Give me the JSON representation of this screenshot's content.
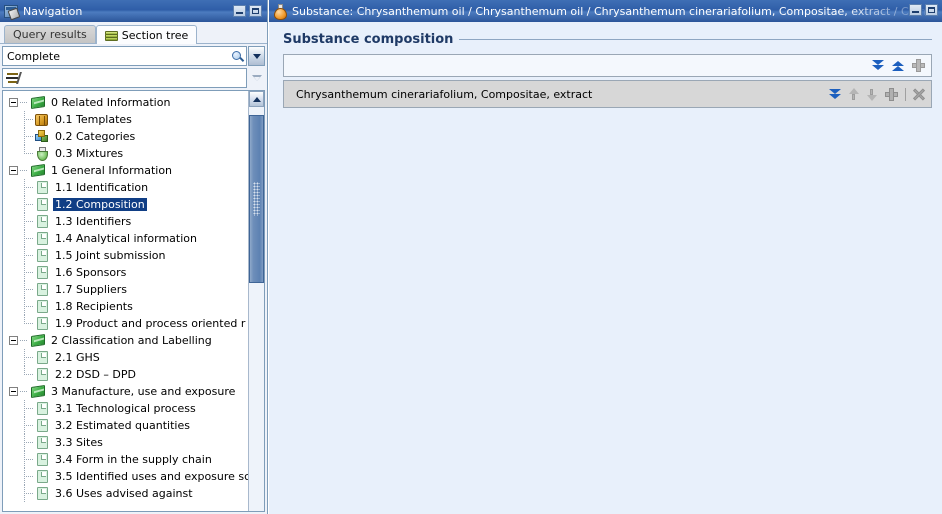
{
  "navigation": {
    "title": "Navigation",
    "icon": "navigation-window-icon",
    "window_buttons": {
      "minimize": "Minimize",
      "maximize": "Maximize"
    },
    "tabs": [
      {
        "label": "Query results",
        "active": false,
        "icon": "none"
      },
      {
        "label": "Section tree",
        "active": true,
        "icon": "stack-icon"
      }
    ],
    "view_combo": {
      "value": "Complete",
      "search_icon": "magnifier-icon",
      "dropdown_icon": "chevron-down-icon"
    },
    "filter": {
      "value": "",
      "placeholder": "",
      "icon": "filter-icon",
      "dropdown_icon": "chevron-down-open-icon"
    },
    "tree": [
      {
        "label": "0 Related Information",
        "level": 0,
        "icon": "book-icon",
        "expander": "minus",
        "selected": false
      },
      {
        "label": "0.1 Templates",
        "level": 1,
        "icon": "template-icon",
        "expander": "none",
        "selected": false
      },
      {
        "label": "0.2 Categories",
        "level": 1,
        "icon": "categories-icon",
        "expander": "none",
        "selected": false
      },
      {
        "label": "0.3 Mixtures",
        "level": 1,
        "icon": "mixtures-icon",
        "expander": "none",
        "selected": false,
        "last": true
      },
      {
        "label": "1 General Information",
        "level": 0,
        "icon": "book-icon",
        "expander": "minus",
        "selected": false
      },
      {
        "label": "1.1 Identification",
        "level": 1,
        "icon": "document-icon",
        "expander": "none",
        "selected": false
      },
      {
        "label": "1.2 Composition",
        "level": 1,
        "icon": "document-icon",
        "expander": "none",
        "selected": true
      },
      {
        "label": "1.3 Identifiers",
        "level": 1,
        "icon": "document-icon",
        "expander": "none",
        "selected": false
      },
      {
        "label": "1.4 Analytical information",
        "level": 1,
        "icon": "document-icon",
        "expander": "none",
        "selected": false
      },
      {
        "label": "1.5 Joint submission",
        "level": 1,
        "icon": "document-icon",
        "expander": "none",
        "selected": false
      },
      {
        "label": "1.6 Sponsors",
        "level": 1,
        "icon": "document-icon",
        "expander": "none",
        "selected": false
      },
      {
        "label": "1.7 Suppliers",
        "level": 1,
        "icon": "document-icon",
        "expander": "none",
        "selected": false
      },
      {
        "label": "1.8 Recipients",
        "level": 1,
        "icon": "document-icon",
        "expander": "none",
        "selected": false
      },
      {
        "label": "1.9 Product and process oriented r",
        "level": 1,
        "icon": "document-icon",
        "expander": "none",
        "selected": false,
        "last": true
      },
      {
        "label": "2 Classification and Labelling",
        "level": 0,
        "icon": "book-icon",
        "expander": "minus",
        "selected": false
      },
      {
        "label": "2.1 GHS",
        "level": 1,
        "icon": "document-icon",
        "expander": "none",
        "selected": false
      },
      {
        "label": "2.2 DSD – DPD",
        "level": 1,
        "icon": "document-icon",
        "expander": "none",
        "selected": false,
        "last": true
      },
      {
        "label": "3 Manufacture, use and exposure",
        "level": 0,
        "icon": "book-icon",
        "expander": "minus",
        "selected": false
      },
      {
        "label": "3.1 Technological process",
        "level": 1,
        "icon": "document-icon",
        "expander": "none",
        "selected": false
      },
      {
        "label": "3.2 Estimated quantities",
        "level": 1,
        "icon": "document-icon",
        "expander": "none",
        "selected": false
      },
      {
        "label": "3.3 Sites",
        "level": 1,
        "icon": "document-icon",
        "expander": "none",
        "selected": false
      },
      {
        "label": "3.4 Form in the supply chain",
        "level": 1,
        "icon": "document-icon",
        "expander": "none",
        "selected": false
      },
      {
        "label": "3.5 Identified uses and exposure sc",
        "level": 1,
        "icon": "document-icon",
        "expander": "none",
        "selected": false
      },
      {
        "label": "3.6 Uses advised against",
        "level": 1,
        "icon": "document-icon",
        "expander": "none",
        "selected": false
      }
    ],
    "scrollbar": {
      "up_arrow": "scroll-up-arrow"
    }
  },
  "document": {
    "icon": "flask-icon",
    "title": "Substance: Chrysanthemum oil / Chrysanthemum oil / Chrysanthemum cinerariafolium, Compositae, extract / Com",
    "window_buttons": {
      "minimize": "Minimize",
      "maximize": "Maximize"
    },
    "group": {
      "title": "Substance composition"
    },
    "header_actions": [
      {
        "name": "collapse-all-icon",
        "label": "Collapse all"
      },
      {
        "name": "expand-all-icon",
        "label": "Expand all"
      },
      {
        "name": "add-icon",
        "label": "Add"
      }
    ],
    "rows": [
      {
        "label": "Chrysanthemum cinerariafolium, Compositae, extract",
        "actions": [
          {
            "name": "expand-row-icon",
            "label": "Expand"
          },
          {
            "name": "move-up-icon",
            "label": "Move up"
          },
          {
            "name": "move-down-icon",
            "label": "Move down"
          },
          {
            "name": "add-row-icon",
            "label": "Add"
          },
          {
            "name": "delete-row-icon",
            "label": "Delete"
          }
        ]
      }
    ]
  },
  "colors": {
    "titlebar_blue": "#2f5ea8",
    "selection_blue": "#103e85",
    "panel_background": "#e8f0fb",
    "row_grey": "#d7d7d7",
    "accent_icon_blue": "#1c5fbe",
    "group_title": "#1f3a66"
  }
}
